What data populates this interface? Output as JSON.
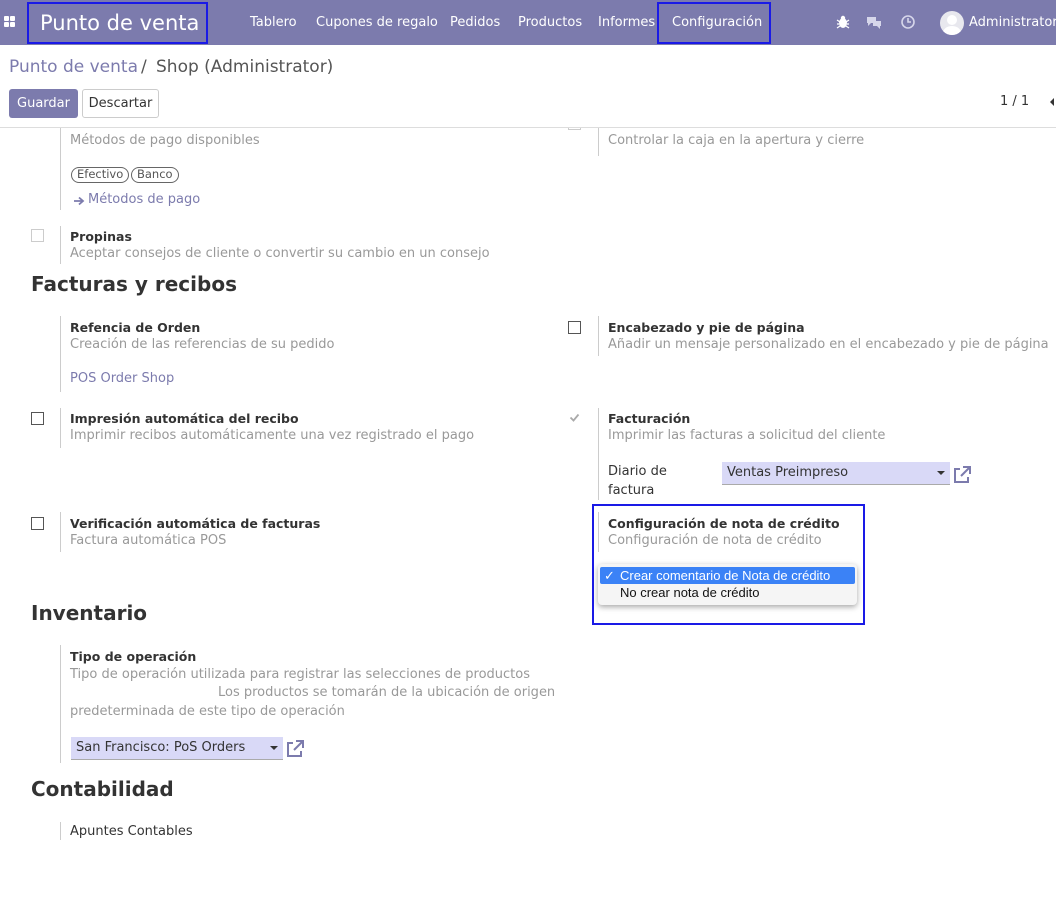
{
  "navbar": {
    "brand": "Punto de venta",
    "menu": [
      "Tablero",
      "Cupones de regalo",
      "Pedidos",
      "Productos",
      "Informes",
      "Configuración"
    ],
    "user": "Administrator",
    "icons": [
      "apps-grid-icon",
      "bug-icon",
      "chat-icon",
      "clock-icon",
      "avatar"
    ]
  },
  "breadcrumb": {
    "parent": "Punto de venta",
    "separator": "/",
    "current": "Shop (Administrator)"
  },
  "buttons": {
    "save": "Guardar",
    "discard": "Descartar"
  },
  "pager": {
    "value": "1 / 1"
  },
  "payments": {
    "help": "Métodos de pago disponibles",
    "tags": [
      "Efectivo",
      "Banco"
    ],
    "link": "Métodos de pago"
  },
  "cash_control": {
    "help": "Controlar la caja en la apertura y cierre"
  },
  "tips": {
    "title": "Propinas",
    "help": "Aceptar consejos de cliente o convertir su cambio en un consejo"
  },
  "sections": {
    "invoices": "Facturas y recibos",
    "inventory": "Inventario",
    "accounting": "Contabilidad"
  },
  "order_ref": {
    "title": "Refencia de Orden",
    "help": "Creación de las referencias de su pedido",
    "link": "POS Order Shop"
  },
  "header_footer": {
    "title": "Encabezado y pie de página",
    "help": "Añadir un mensaje personalizado en el encabezado y pie de página"
  },
  "auto_print": {
    "title": "Impresión automática del recibo",
    "help": "Imprimir recibos automáticamente una vez registrado el pago"
  },
  "invoicing": {
    "title": "Facturación",
    "help": "Imprimir las facturas a solicitud del cliente",
    "journal_label_1": "Diario de",
    "journal_label_2": "factura",
    "journal_value": "Ventas Preimpreso"
  },
  "auto_invoice": {
    "title": "Verificación automática de facturas",
    "help": "Factura automática POS"
  },
  "credit_note": {
    "title": "Configuración de nota de crédito",
    "help": "Configuración de nota de crédito",
    "options": [
      "Crear comentario de Nota de crédito",
      "No crear nota de crédito"
    ],
    "selected": "Crear comentario de Nota de crédito",
    "check": "✓"
  },
  "operation_type": {
    "title": "Tipo de operación",
    "help_1": "Tipo de operación utilizada para registrar las selecciones de productos",
    "help_2": "Los productos se tomarán de la ubicación de origen",
    "help_3": "predeterminada de este tipo de operación",
    "value": "San Francisco: PoS Orders"
  },
  "accounting_entries": {
    "label": "Apuntes Contables"
  },
  "colors": {
    "navbar": "#7c7bad",
    "accent": "#7c7bad",
    "highlight_border": "#1a1ae6",
    "select_bg": "#d9d9f7",
    "dropdown_selected": "#3b82f6"
  }
}
